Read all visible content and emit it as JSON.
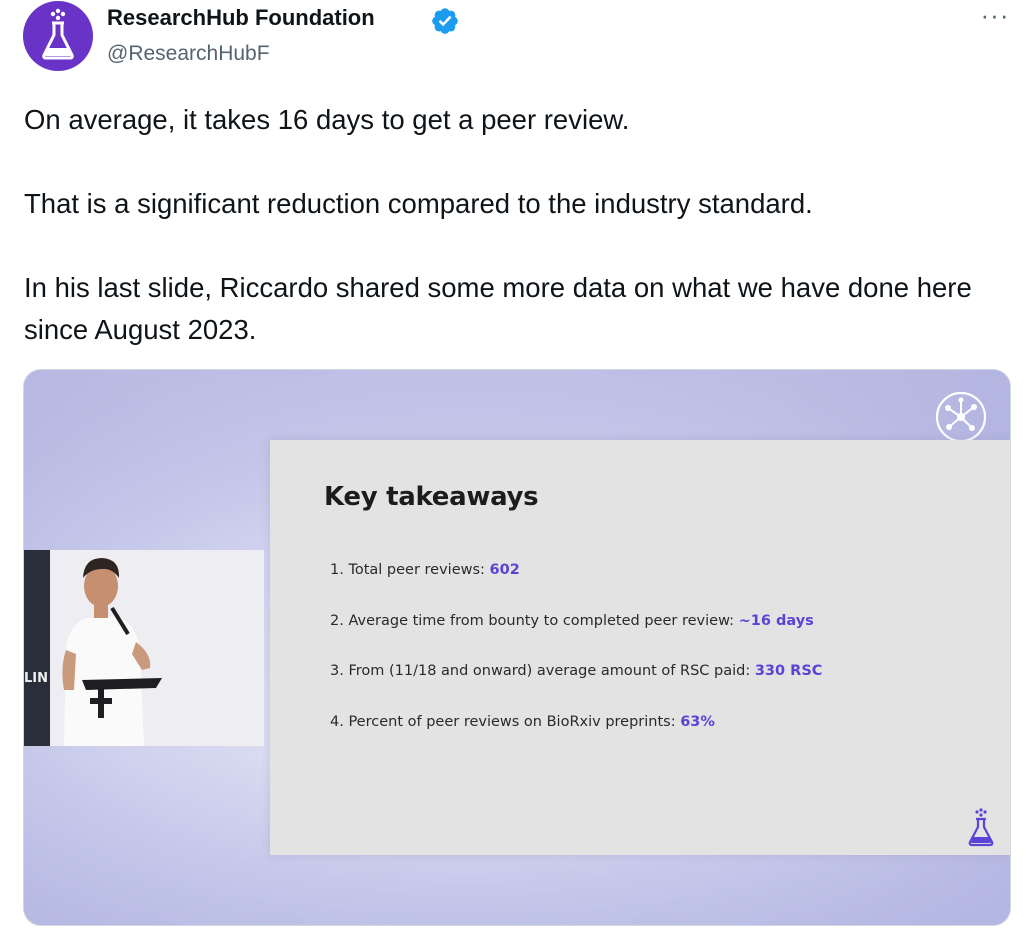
{
  "author": {
    "display_name": "ResearchHub Foundation",
    "handle": "@ResearchHubF",
    "verified": true,
    "avatar_icon": "flask-icon",
    "brand_color": "#6a33c8"
  },
  "more_label": "···",
  "tweet": {
    "paragraphs": [
      "On average, it takes 16 days to get a peer review.",
      "That is a significant reduction compared to the industry standard.",
      "In his last slide, Riccardo shared some more data on what we have done here since August 2023."
    ]
  },
  "slide": {
    "title": "Key takeaways",
    "items": [
      {
        "text": "1. Total peer reviews: ",
        "highlight": "602"
      },
      {
        "text": "2. Average time from bounty to completed peer review: ",
        "highlight": "~16 days"
      },
      {
        "text": "3. From (11/18 and onward) average amount of RSC paid: ",
        "highlight": "330 RSC"
      },
      {
        "text": "4. Percent of peer reviews on BioRxiv preprints: ",
        "highlight": "63%"
      }
    ],
    "highlight_color": "#5b43d6"
  },
  "video_inset": {
    "sign_text": "LIN"
  }
}
